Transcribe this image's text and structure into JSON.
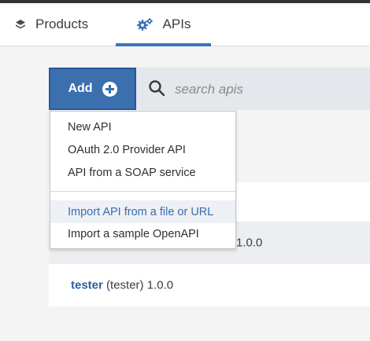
{
  "tabs": [
    {
      "label": "Products",
      "icon": "layers-icon",
      "active": false
    },
    {
      "label": "APIs",
      "icon": "gears-icon",
      "active": true
    }
  ],
  "toolbar": {
    "add_label": "Add",
    "search": {
      "placeholder": "search apis",
      "value": ""
    }
  },
  "add_menu": {
    "items": [
      {
        "label": "New API"
      },
      {
        "label": "OAuth 2.0 Provider API"
      },
      {
        "label": "API from a SOAP service"
      },
      {
        "label": "Import API from a file or URL",
        "highlighted": true
      },
      {
        "label": "Import a sample OpenAPI"
      }
    ]
  },
  "api_list": {
    "rows": [
      {
        "title": "",
        "detail": ""
      },
      {
        "title": "",
        "detail": "1.0.0"
      },
      {
        "title": "tester",
        "detail": " (tester) 1.0.0"
      }
    ]
  },
  "colors": {
    "accent": "#3b6fae",
    "link": "#2a5ea4",
    "highlight_text": "#3a6db0",
    "toolbar_bg": "#e4e8ed"
  }
}
